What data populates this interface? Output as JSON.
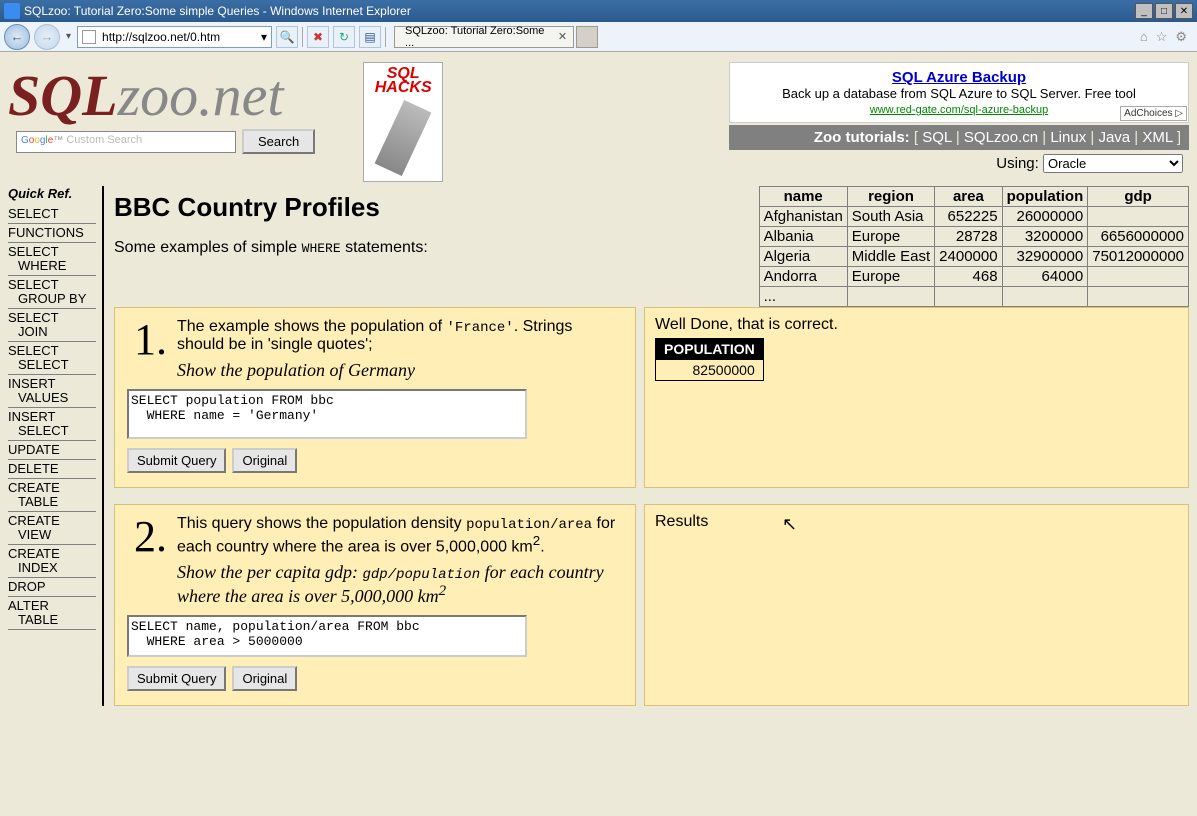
{
  "window": {
    "title": "SQLzoo: Tutorial Zero:Some simple Queries - Windows Internet Explorer",
    "url": "http://sqlzoo.net/0.htm",
    "tab_title": "SQLzoo: Tutorial Zero:Some ..."
  },
  "logo": {
    "sql": "SQL",
    "rest": "zoo.net"
  },
  "book": {
    "line1": "SQL",
    "line2": "HACKS"
  },
  "ad": {
    "title": "SQL Azure Backup",
    "text": "Back up a database from SQL Azure to SQL Server. Free tool",
    "url": "www.red-gate.com/sql-azure-backup",
    "adchoices": "AdChoices"
  },
  "tutorials_bar": {
    "label": "Zoo tutorials:",
    "links": [
      "SQL",
      "SQLzoo.cn",
      "Linux",
      "Java",
      "XML"
    ]
  },
  "using": {
    "label": "Using:",
    "value": "Oracle"
  },
  "search": {
    "placeholder": "Custom Search",
    "button": "Search",
    "google": "Google™"
  },
  "sidebar": {
    "heading": "Quick Ref.",
    "items": [
      {
        "t": "SELECT"
      },
      {
        "t": "FUNCTIONS"
      },
      {
        "t": "SELECT",
        "s": "WHERE"
      },
      {
        "t": "SELECT",
        "s": "GROUP BY"
      },
      {
        "t": "SELECT",
        "s": "JOIN"
      },
      {
        "t": "SELECT",
        "s": "SELECT"
      },
      {
        "t": "INSERT",
        "s": "VALUES"
      },
      {
        "t": "INSERT",
        "s": "SELECT"
      },
      {
        "t": "UPDATE"
      },
      {
        "t": "DELETE"
      },
      {
        "t": "CREATE",
        "s": "TABLE"
      },
      {
        "t": "CREATE",
        "s": "VIEW"
      },
      {
        "t": "CREATE",
        "s": "INDEX"
      },
      {
        "t": "DROP"
      },
      {
        "t": "ALTER",
        "s": "TABLE"
      }
    ]
  },
  "page_title": "BBC Country Profiles",
  "intro_pre": "Some examples of simple ",
  "intro_code": "WHERE",
  "intro_post": " statements:",
  "ref_headers": [
    "name",
    "region",
    "area",
    "population",
    "gdp"
  ],
  "ref_rows": [
    [
      "Afghanistan",
      "South Asia",
      "652225",
      "26000000",
      ""
    ],
    [
      "Albania",
      "Europe",
      "28728",
      "3200000",
      "6656000000"
    ],
    [
      "Algeria",
      "Middle East",
      "2400000",
      "32900000",
      "75012000000"
    ],
    [
      "Andorra",
      "Europe",
      "468",
      "64000",
      ""
    ],
    [
      "...",
      "",
      "",
      "",
      ""
    ]
  ],
  "ex1": {
    "num": "1.",
    "desc_pre": "The example shows the population of ",
    "desc_code": "'France'",
    "desc_post": ". Strings should be in 'single quotes';",
    "task": "Show the population of Germany",
    "sql": "SELECT population FROM bbc\n  WHERE name = 'Germany'",
    "submit": "Submit Query",
    "original": "Original",
    "result_msg": "Well Done, that is correct.",
    "result_header": "POPULATION",
    "result_value": "82500000"
  },
  "ex2": {
    "num": "2.",
    "desc_pre": "This query shows the population density ",
    "desc_code": "population/area",
    "desc_post1": " for each country where the area is over 5,000,000 km",
    "desc_sup1": "2",
    "desc_post2": ".",
    "task_pre": "Show the per capita gdp: ",
    "task_code": "gdp/population",
    "task_post1": " for each country where the area is over 5,000,000 km",
    "task_sup": "2",
    "sql": "SELECT name, population/area FROM bbc\n  WHERE area > 5000000",
    "submit": "Submit Query",
    "original": "Original",
    "results_label": "Results"
  }
}
